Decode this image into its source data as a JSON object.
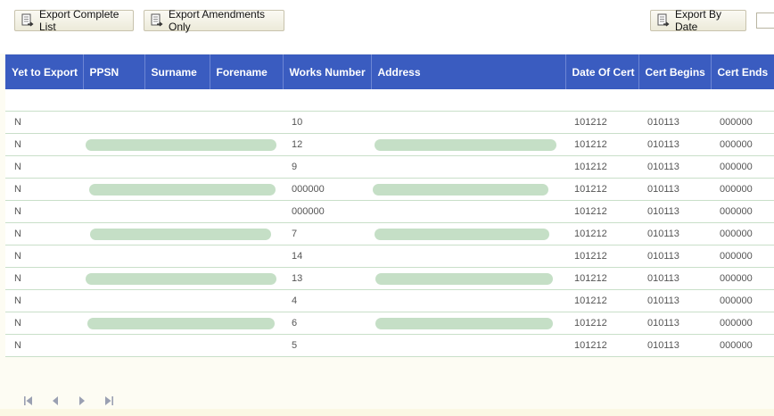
{
  "toolbar": {
    "export_complete_label": "Export Complete List",
    "export_amendments_label": "Export Amendments Only",
    "export_by_date_label": "Export By Date"
  },
  "columns": [
    "Yet to Export",
    "PPSN",
    "Surname",
    "Forename",
    "Works Number",
    "Address",
    "Date Of Cert",
    "Cert Begins",
    "Cert Ends"
  ],
  "rows": [
    {
      "yet_to_export": "N",
      "works_number": "10",
      "date_of_cert": "101212",
      "cert_begins": "010113",
      "cert_ends": "000000"
    },
    {
      "yet_to_export": "N",
      "works_number": "12",
      "date_of_cert": "101212",
      "cert_begins": "010113",
      "cert_ends": "000000"
    },
    {
      "yet_to_export": "N",
      "works_number": "9",
      "date_of_cert": "101212",
      "cert_begins": "010113",
      "cert_ends": "000000"
    },
    {
      "yet_to_export": "N",
      "works_number": "000000",
      "date_of_cert": "101212",
      "cert_begins": "010113",
      "cert_ends": "000000"
    },
    {
      "yet_to_export": "N",
      "works_number": "000000",
      "date_of_cert": "101212",
      "cert_begins": "010113",
      "cert_ends": "000000"
    },
    {
      "yet_to_export": "N",
      "works_number": "7",
      "date_of_cert": "101212",
      "cert_begins": "010113",
      "cert_ends": "000000"
    },
    {
      "yet_to_export": "N",
      "works_number": "14",
      "date_of_cert": "101212",
      "cert_begins": "010113",
      "cert_ends": "000000"
    },
    {
      "yet_to_export": "N",
      "works_number": "13",
      "date_of_cert": "101212",
      "cert_begins": "010113",
      "cert_ends": "000000"
    },
    {
      "yet_to_export": "N",
      "works_number": "4",
      "date_of_cert": "101212",
      "cert_begins": "010113",
      "cert_ends": "000000"
    },
    {
      "yet_to_export": "N",
      "works_number": "6",
      "date_of_cert": "101212",
      "cert_begins": "010113",
      "cert_ends": "000000"
    },
    {
      "yet_to_export": "N",
      "works_number": "5",
      "date_of_cert": "101212",
      "cert_begins": "010113",
      "cert_ends": "000000"
    }
  ],
  "redacted_rows": [
    1,
    3,
    5,
    7,
    9
  ],
  "pager": {
    "icons": [
      "first-page-icon",
      "previous-page-icon",
      "next-page-icon",
      "last-page-icon"
    ]
  },
  "colors": {
    "header_bg": "#3a5cc0",
    "header_text": "#ffffff",
    "redaction": "#c5dfc6",
    "row_border": "#c9dfc9",
    "page_bg": "#fdfcf3"
  }
}
